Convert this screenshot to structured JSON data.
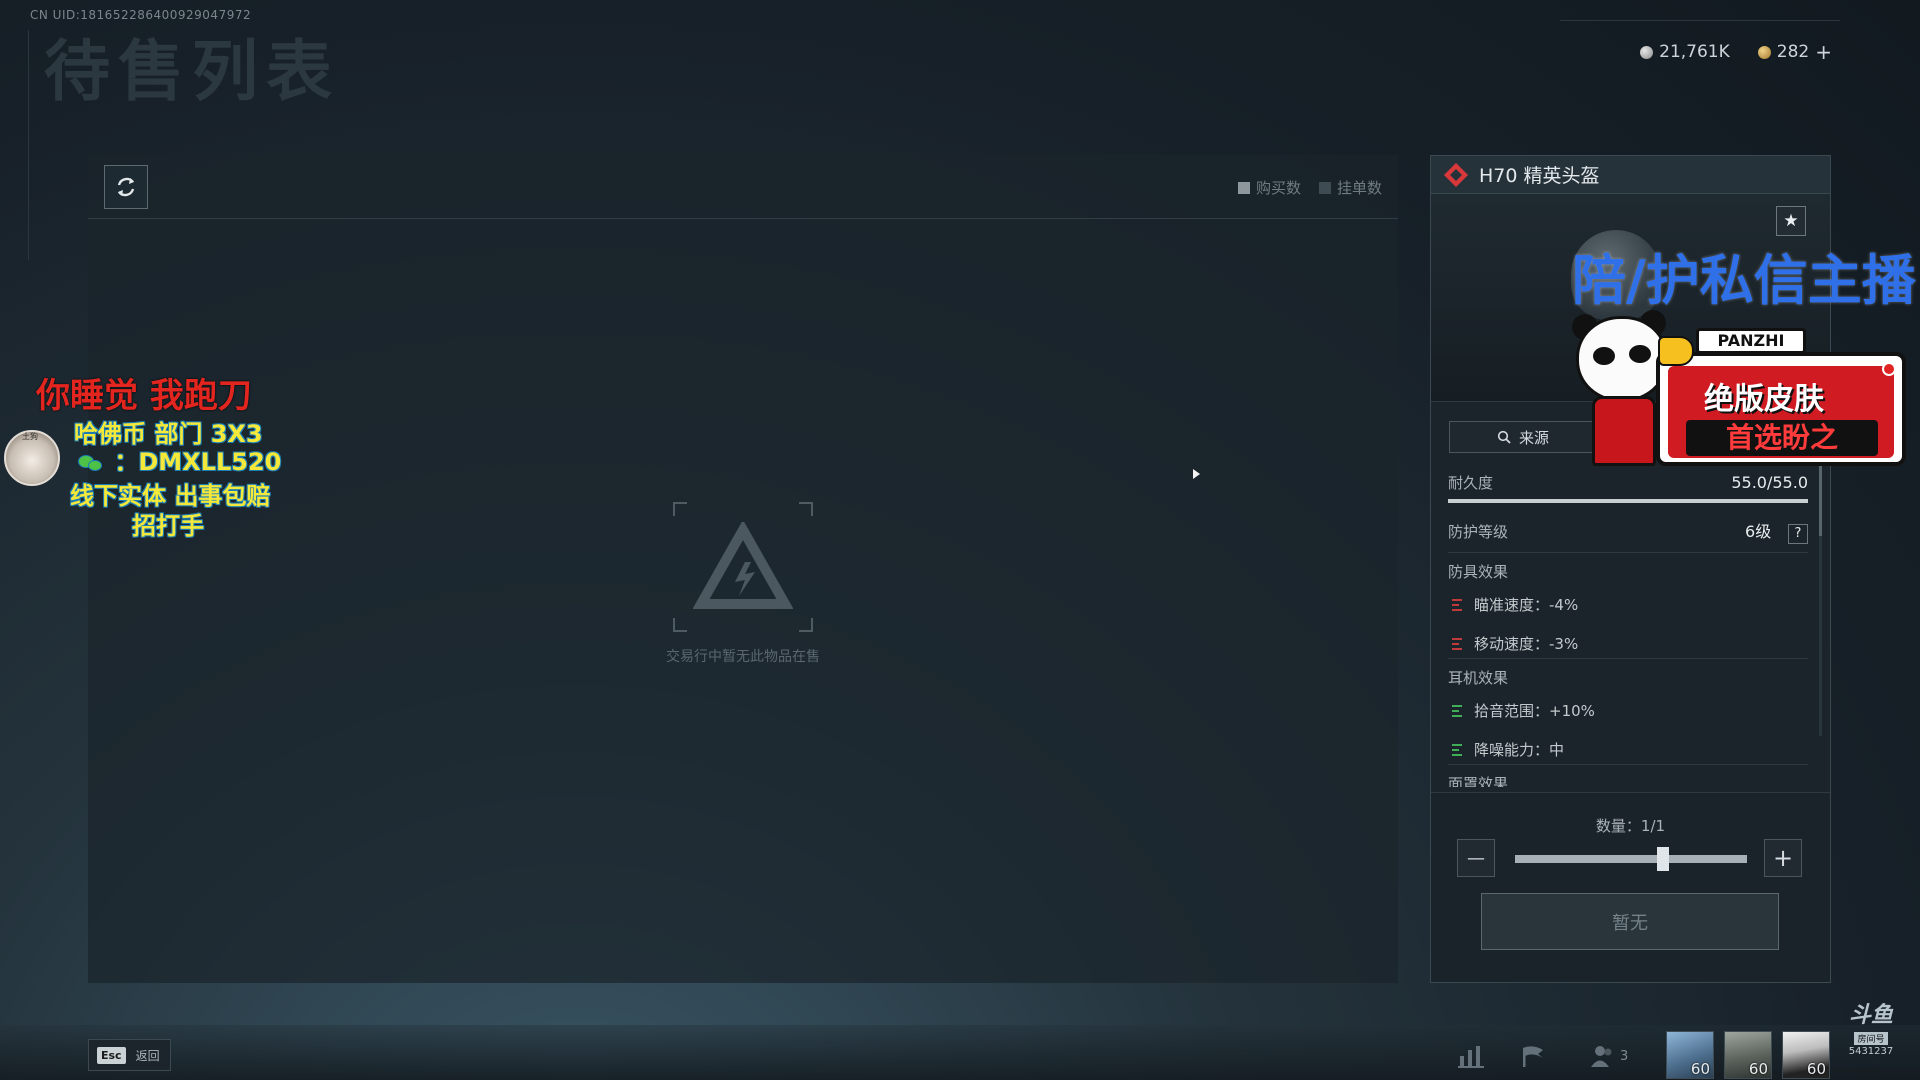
{
  "header": {
    "uid": "CN UID:1816522864009290479​72",
    "page_title": "待售列表"
  },
  "currency": {
    "silver": "21,761K",
    "gold": "282",
    "add_symbol": "+"
  },
  "market": {
    "legend_buy": "购买数",
    "legend_list": "挂单数",
    "empty_message": "交易行中暂无此物品在售"
  },
  "item": {
    "name": "H70 精英头盔",
    "rarity_color": "#d8383a",
    "source_label": "来源",
    "durability_label": "耐久度",
    "durability_value": "55.0/55.0",
    "durability_fraction": 1.0,
    "protection_label": "防护等级",
    "protection_value": "6级",
    "help_symbol": "?",
    "armor_effects_title": "防具效果",
    "armor_effects": [
      {
        "text": "瞄准速度：-4%",
        "type": "negative"
      },
      {
        "text": "移动速度：-3%",
        "type": "negative"
      }
    ],
    "headset_effects_title": "耳机效果",
    "headset_effects": [
      {
        "text": "拾音范围：+10%",
        "type": "positive"
      },
      {
        "text": "降噪能力：中",
        "type": "positive"
      }
    ],
    "mask_effects_title": "面罩效果"
  },
  "purchase": {
    "quantity_label": "数量：1/1",
    "quantity_fraction": 1.0,
    "minus_symbol": "—",
    "plus_symbol": "+",
    "action_label": "暂无"
  },
  "bottom": {
    "esc_key": "Esc",
    "esc_label": "返回",
    "friends_count": "3",
    "team": [
      {
        "level": "60"
      },
      {
        "level": "60"
      },
      {
        "level": "60"
      }
    ]
  },
  "stream_overlay": {
    "red_line": "你睡觉 我跑刀",
    "line_1": "哈佛币 部门 3X3",
    "line_2": "：DMXLL520",
    "line_3": "线下实体 出事包赔",
    "line_4": "招打手",
    "avatar_tag": "土狗",
    "blue_line": "陪/护私信主播",
    "sticker_name": "PANZHI",
    "sticker_line1": "绝版皮肤",
    "sticker_line2": "首选盼之"
  },
  "watermark": {
    "logo": "斗鱼",
    "sub": "房间号",
    "room": "5431237"
  },
  "colors": {
    "negative": "#c0393b",
    "positive": "#3fae57",
    "overlay_red": "#e2261f",
    "overlay_yellow": "#f4e83a",
    "overlay_blue": "#2f6fe8"
  }
}
